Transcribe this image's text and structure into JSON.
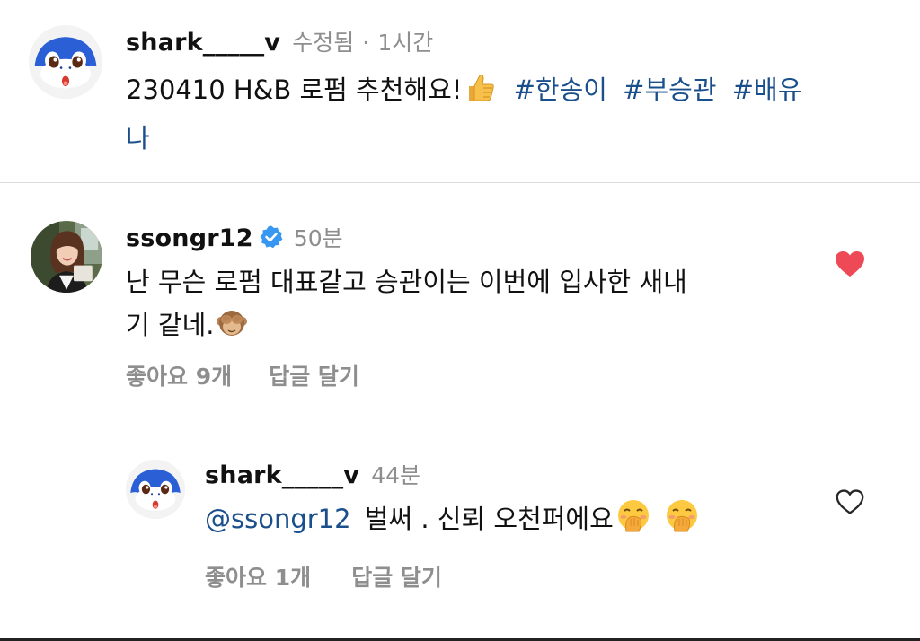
{
  "caption": {
    "username": "shark_____v",
    "edited": "수정됨",
    "dot": "·",
    "time": "1시간",
    "text": "230410 H&B 로펌 추천해요!",
    "emoji": "thumbs-up-emoji",
    "hashtags": [
      "#한송이",
      "#부승관",
      "#배유"
    ],
    "wrap_text": "나"
  },
  "comment": {
    "username": "ssongr12",
    "verified": "verified-badge-icon",
    "time": "50분",
    "line1": "난 무슨 로펌 대표같고 승관이는 이번에 입사한 새내",
    "line2": "기 같네.",
    "emoji": "see-no-evil-monkey-emoji",
    "likes": "좋아요 9개",
    "reply": "답글 달기",
    "liked": true,
    "heart_color": "#ed4956"
  },
  "reply": {
    "username": "shark_____v",
    "time": "44분",
    "mention": "@ssongr12",
    "text": "벌써 . 신뢰 오천퍼에요",
    "emojis": [
      "hand-over-mouth-emoji",
      "hand-over-mouth-emoji"
    ],
    "likes": "좋아요 1개",
    "reply": "답글 달기",
    "liked": false
  },
  "colors": {
    "hashtag": "#1b4f8c",
    "meta": "#8e8e8e",
    "divider": "#dbdbdb",
    "shark_blue": "#2a5fd6"
  }
}
